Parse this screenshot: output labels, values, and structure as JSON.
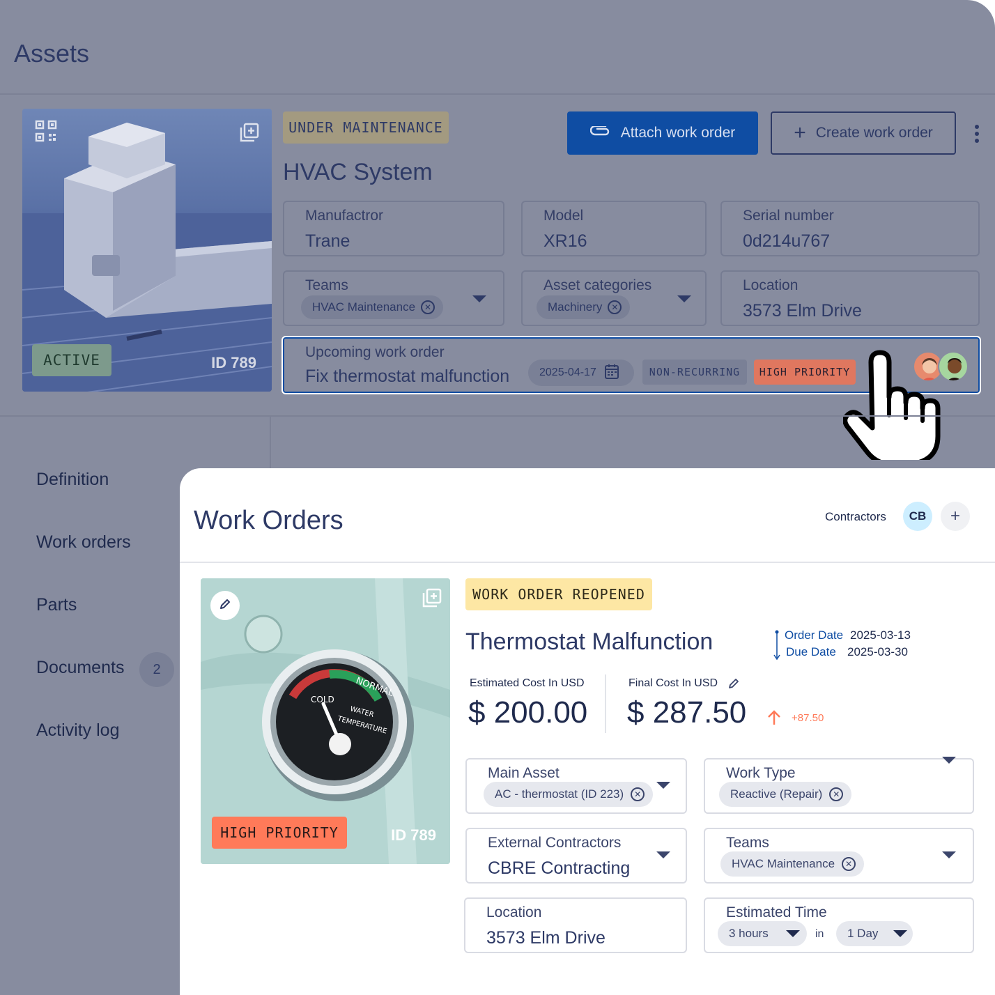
{
  "app": {
    "title": "Assets"
  },
  "asset": {
    "status_badge": "ACTIVE",
    "id_label": "ID 789",
    "maintenance_badge": "UNDER MAINTENANCE",
    "name": "HVAC System",
    "attach_button": "Attach work order",
    "create_button": "Create work order",
    "fields": {
      "manufacturer": {
        "label": "Manufactror",
        "value": "Trane"
      },
      "model": {
        "label": "Model",
        "value": "XR16"
      },
      "serial": {
        "label": "Serial number",
        "value": "0d214u767"
      },
      "teams": {
        "label": "Teams",
        "chip": "HVAC Maintenance"
      },
      "categories": {
        "label": "Asset categories",
        "chip": "Machinery"
      },
      "location": {
        "label": "Location",
        "value": "3573 Elm Drive"
      }
    },
    "upcoming": {
      "label": "Upcoming work order",
      "title": "Fix thermostat malfunction",
      "date": "2025-04-17",
      "recurrence": "NON-RECURRING",
      "priority": "HIGH PRIORITY"
    }
  },
  "nav": {
    "items": [
      {
        "label": "Definition"
      },
      {
        "label": "Work orders"
      },
      {
        "label": "Parts"
      },
      {
        "label": "Documents",
        "count": "2"
      },
      {
        "label": "Activity log"
      }
    ]
  },
  "work_orders": {
    "title": "Work Orders",
    "contractors_label": "Contractors",
    "contractor_avatar": "CB",
    "image_priority": "HIGH PRIORITY",
    "image_id": "ID 789",
    "status_badge": "WORK ORDER REOPENED",
    "name": "Thermostat Malfunction",
    "order_date_label": "Order Date",
    "order_date": "2025-03-13",
    "due_date_label": "Due Date",
    "due_date": "2025-03-30",
    "estimated_cost_label": "Estimated Cost In USD",
    "estimated_cost": "$ 200.00",
    "final_cost_label": "Final Cost In USD",
    "final_cost": "$ 287.50",
    "cost_delta": "+87.50",
    "fields": {
      "main_asset": {
        "label": "Main Asset",
        "chip": "AC - thermostat (ID 223)"
      },
      "work_type": {
        "label": "Work Type",
        "chip": "Reactive (Repair)"
      },
      "contractors": {
        "label": "External Contractors",
        "value": "CBRE Contracting"
      },
      "teams": {
        "label": "Teams",
        "chip": "HVAC Maintenance"
      },
      "location": {
        "label": "Location",
        "value": "3573 Elm Drive"
      },
      "estimated_time": {
        "label": "Estimated Time",
        "hours": "3 hours",
        "in": "in",
        "days": "1 Day"
      }
    }
  },
  "colors": {
    "primary": "#0f4da3",
    "high_priority": "#ff7a59",
    "reopened": "#fde7a4",
    "backdrop": "#878c9f",
    "text": "#2a3358"
  }
}
